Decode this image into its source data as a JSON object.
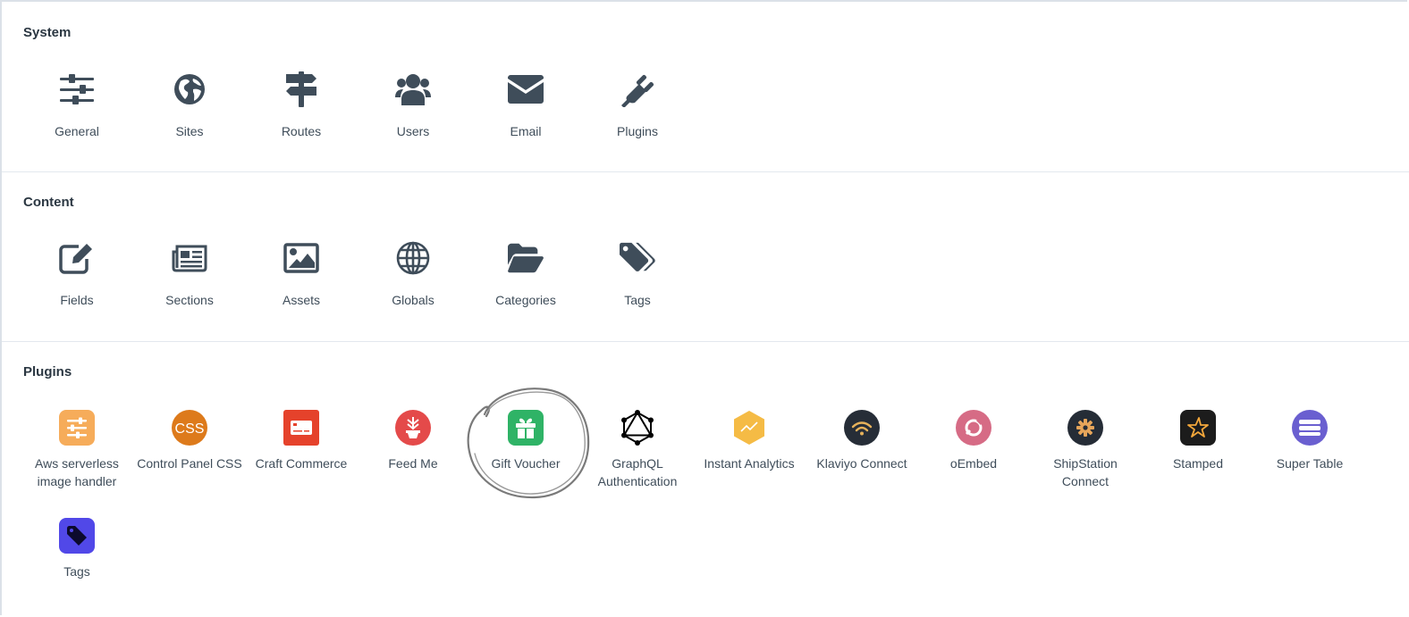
{
  "sections": {
    "system": {
      "title": "System",
      "items": [
        {
          "label": "General",
          "icon": "sliders-icon"
        },
        {
          "label": "Sites",
          "icon": "globe-americas-icon"
        },
        {
          "label": "Routes",
          "icon": "signpost-icon"
        },
        {
          "label": "Users",
          "icon": "users-icon"
        },
        {
          "label": "Email",
          "icon": "envelope-icon"
        },
        {
          "label": "Plugins",
          "icon": "plug-icon"
        }
      ]
    },
    "content": {
      "title": "Content",
      "items": [
        {
          "label": "Fields",
          "icon": "edit-icon"
        },
        {
          "label": "Sections",
          "icon": "newspaper-icon"
        },
        {
          "label": "Assets",
          "icon": "image-icon"
        },
        {
          "label": "Globals",
          "icon": "globe-icon"
        },
        {
          "label": "Categories",
          "icon": "folder-open-icon"
        },
        {
          "label": "Tags",
          "icon": "tags-icon"
        }
      ]
    },
    "plugins": {
      "title": "Plugins",
      "items": [
        {
          "label": "Aws serverless image handler",
          "icon": "aws-serverless-icon",
          "color": "#f6ac5a"
        },
        {
          "label": "Control Panel CSS",
          "icon": "css-icon",
          "color": "#dd7a1b"
        },
        {
          "label": "Craft Commerce",
          "icon": "commerce-icon",
          "color": "#e5422b"
        },
        {
          "label": "Feed Me",
          "icon": "feed-me-icon",
          "color": "#e44a4a"
        },
        {
          "label": "Gift Voucher",
          "icon": "gift-icon",
          "color": "#2fb366"
        },
        {
          "label": "GraphQL Authentication",
          "icon": "graphql-icon",
          "color": "#000000"
        },
        {
          "label": "Instant Analytics",
          "icon": "instant-analytics-icon",
          "color": "#f5bb45"
        },
        {
          "label": "Klaviyo Connect",
          "icon": "klaviyo-icon",
          "color": "#262d37"
        },
        {
          "label": "oEmbed",
          "icon": "oembed-icon",
          "color": "#d66b85"
        },
        {
          "label": "ShipStation Connect",
          "icon": "shipstation-icon",
          "color": "#252c36"
        },
        {
          "label": "Stamped",
          "icon": "stamped-icon",
          "color": "#1c1c1c"
        },
        {
          "label": "Super Table",
          "icon": "super-table-icon",
          "color": "#6a5fd0"
        },
        {
          "label": "Tags",
          "icon": "tag-icon",
          "color": "#5148e8"
        }
      ]
    }
  },
  "colors": {
    "icon": "#3f4d5a",
    "title": "#2b3742",
    "annotation": "#777777"
  }
}
